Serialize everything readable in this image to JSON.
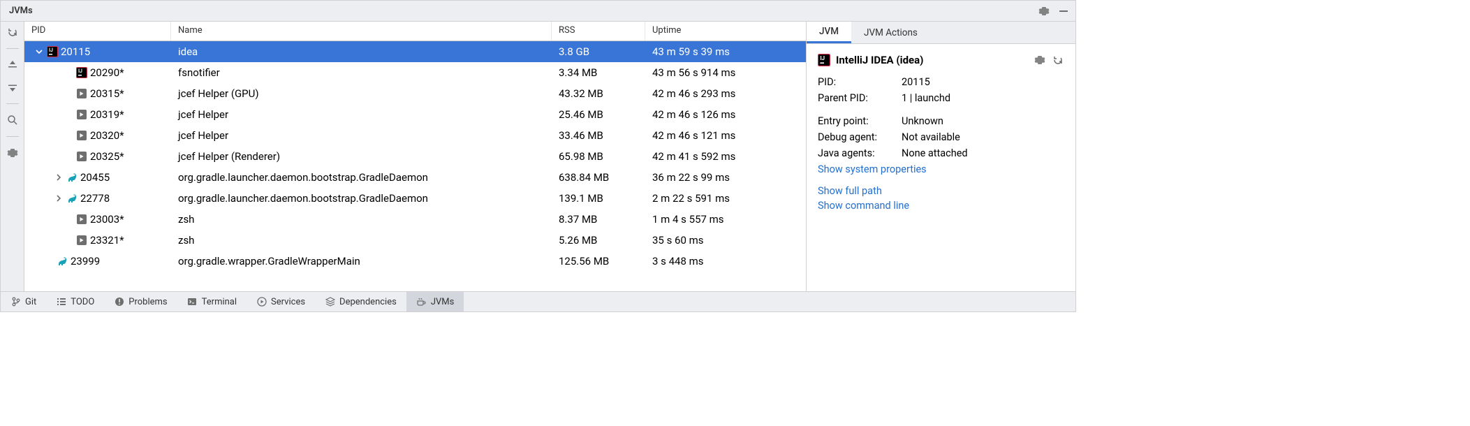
{
  "panel_title": "JVMs",
  "columns": {
    "pid": "PID",
    "name": "Name",
    "rss": "RSS",
    "uptime": "Uptime"
  },
  "rows": [
    {
      "pid": "20115",
      "name": "idea",
      "rss": "3.8 GB",
      "uptime": "43 m 59 s 39 ms",
      "icon": "ij",
      "depth": 0,
      "chevron": "down",
      "selected": true
    },
    {
      "pid": "20290*",
      "name": "fsnotifier",
      "rss": "3.34 MB",
      "uptime": "43 m 56 s 914 ms",
      "icon": "ij",
      "depth": 1,
      "chevron": ""
    },
    {
      "pid": "20315*",
      "name": "jcef Helper (GPU)",
      "rss": "43.32 MB",
      "uptime": "42 m 46 s 293 ms",
      "icon": "exec",
      "depth": 1,
      "chevron": ""
    },
    {
      "pid": "20319*",
      "name": "jcef Helper",
      "rss": "25.46 MB",
      "uptime": "42 m 46 s 126 ms",
      "icon": "exec",
      "depth": 1,
      "chevron": ""
    },
    {
      "pid": "20320*",
      "name": "jcef Helper",
      "rss": "33.46 MB",
      "uptime": "42 m 46 s 121 ms",
      "icon": "exec",
      "depth": 1,
      "chevron": ""
    },
    {
      "pid": "20325*",
      "name": "jcef Helper (Renderer)",
      "rss": "65.98 MB",
      "uptime": "42 m 41 s 592 ms",
      "icon": "exec",
      "depth": 1,
      "chevron": ""
    },
    {
      "pid": "20455",
      "name": "org.gradle.launcher.daemon.bootstrap.GradleDaemon",
      "rss": "638.84 MB",
      "uptime": "36 m 22 s 99 ms",
      "icon": "gradle",
      "depth": 1,
      "chevron": "right"
    },
    {
      "pid": "22778",
      "name": "org.gradle.launcher.daemon.bootstrap.GradleDaemon",
      "rss": "139.1 MB",
      "uptime": "2 m 22 s 591 ms",
      "icon": "gradle",
      "depth": 1,
      "chevron": "right"
    },
    {
      "pid": "23003*",
      "name": "zsh",
      "rss": "8.37 MB",
      "uptime": "1 m 4 s 557 ms",
      "icon": "exec",
      "depth": 1,
      "chevron": ""
    },
    {
      "pid": "23321*",
      "name": "zsh",
      "rss": "5.26 MB",
      "uptime": "35 s 60 ms",
      "icon": "exec",
      "depth": 1,
      "chevron": ""
    },
    {
      "pid": "23999",
      "name": "org.gradle.wrapper.GradleWrapperMain",
      "rss": "125.56 MB",
      "uptime": "3 s 448 ms",
      "icon": "gradle",
      "depth": 0,
      "chevron": ""
    }
  ],
  "tabs": {
    "jvm": "JVM",
    "actions": "JVM Actions"
  },
  "details": {
    "title": "IntelliJ IDEA (idea)",
    "pid_label": "PID:",
    "pid": "20115",
    "ppid_label": "Parent PID:",
    "ppid": "1 | launchd",
    "entry_label": "Entry point:",
    "entry": "Unknown",
    "debug_label": "Debug agent:",
    "debug": "Not available",
    "agents_label": "Java agents:",
    "agents": "None attached",
    "link_sysprops": "Show system properties",
    "link_fullpath": "Show full path",
    "link_cmdline": "Show command line"
  },
  "bottom": {
    "git": "Git",
    "todo": "TODO",
    "problems": "Problems",
    "terminal": "Terminal",
    "services": "Services",
    "dependencies": "Dependencies",
    "jvms": "JVMs"
  }
}
